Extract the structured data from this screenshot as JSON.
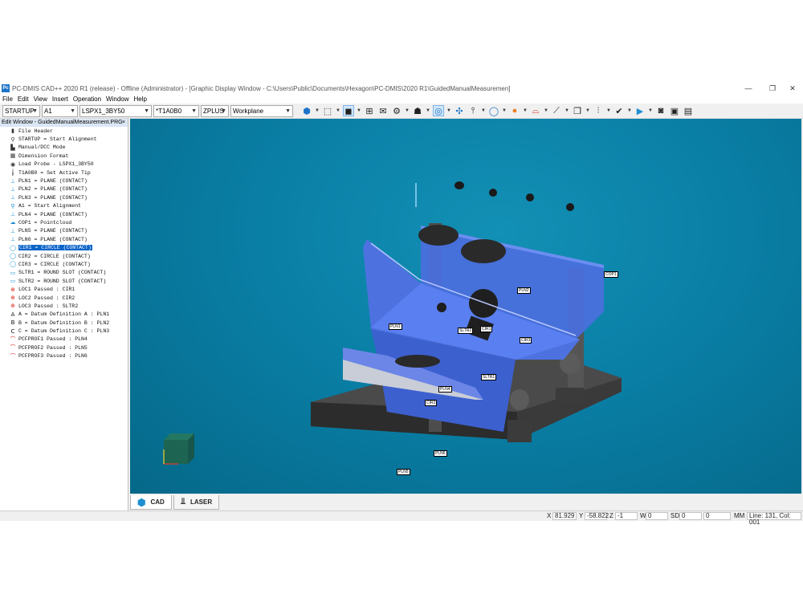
{
  "window": {
    "title": "PC-DMIS CAD++ 2020 R1 (release) - Offline (Administrator) - [Graphic Display Window - C:\\Users\\Public\\Documents\\Hexagon\\PC-DMIS\\2020 R1\\GuidedManualMeasuremen]",
    "logo": "Pc",
    "minimize": "—",
    "maximize": "❐",
    "close": "✕"
  },
  "menu": [
    "File",
    "Edit",
    "View",
    "Insert",
    "Operation",
    "Window",
    "Help"
  ],
  "toolbar": {
    "alignment": "STARTUP",
    "alignment_item": "A1",
    "probe": "LSPX1_3BY50",
    "tip": "*T1A0B0",
    "view": "ZPLUS",
    "workplane": "Workplane"
  },
  "edit_window": {
    "title": "Edit Window - GuidedManualMeasurement.PRG",
    "close": "×",
    "commands": [
      {
        "icon": "file-icon",
        "glyph": "▮",
        "color": "#333333",
        "text": "File Header"
      },
      {
        "icon": "alignment-icon",
        "glyph": "⚲",
        "color": "#333333",
        "text": "STARTUP = Start Alignment"
      },
      {
        "icon": "mode-icon",
        "glyph": "▙",
        "color": "#333333",
        "text": "Manual/DCC Mode"
      },
      {
        "icon": "format-icon",
        "glyph": "▦",
        "color": "#333333",
        "text": "Dimension Format"
      },
      {
        "icon": "probe-icon",
        "glyph": "◉",
        "color": "#333333",
        "text": "Load Probe - LSPX1_3BY50"
      },
      {
        "icon": "tip-icon",
        "glyph": "╽",
        "color": "#333333",
        "text": "T1A0B0 = Set Active Tip"
      },
      {
        "icon": "plane-icon",
        "glyph": "⊥",
        "color": "#1e8fd0",
        "text": "PLN1 = PLANE (CONTACT)"
      },
      {
        "icon": "plane-icon",
        "glyph": "⊥",
        "color": "#1e8fd0",
        "text": "PLN2 = PLANE (CONTACT)"
      },
      {
        "icon": "plane-icon",
        "glyph": "⊥",
        "color": "#1e8fd0",
        "text": "PLN3 = PLANE (CONTACT)"
      },
      {
        "icon": "alignment-icon",
        "glyph": "⚲",
        "color": "#1e8fd0",
        "text": "A1 = Start Alignment"
      },
      {
        "icon": "plane-icon",
        "glyph": "⊥",
        "color": "#1e8fd0",
        "text": "PLN4 = PLANE (CONTACT)"
      },
      {
        "icon": "pointcloud-icon",
        "glyph": "☁",
        "color": "#1e8fd0",
        "text": "COP1 = Pointcloud"
      },
      {
        "icon": "plane-icon",
        "glyph": "⊥",
        "color": "#1e8fd0",
        "text": "PLN5 = PLANE (CONTACT)"
      },
      {
        "icon": "plane-icon",
        "glyph": "⊥",
        "color": "#1e8fd0",
        "text": "PLN6 = PLANE (CONTACT)"
      },
      {
        "icon": "circle-icon",
        "glyph": "◯",
        "color": "#1e8fd0",
        "text": "CIR1 = CIRCLE (CONTACT)",
        "selected": true
      },
      {
        "icon": "circle-icon",
        "glyph": "◯",
        "color": "#1e8fd0",
        "text": "CIR2 = CIRCLE (CONTACT)"
      },
      {
        "icon": "circle-icon",
        "glyph": "◯",
        "color": "#1e8fd0",
        "text": "CIR3 = CIRCLE (CONTACT)"
      },
      {
        "icon": "slot-icon",
        "glyph": "▭",
        "color": "#1e8fd0",
        "text": "SLTR1 = ROUND SLOT (CONTACT)"
      },
      {
        "icon": "slot-icon",
        "glyph": "▭",
        "color": "#1e8fd0",
        "text": "SLTR2 = ROUND SLOT (CONTACT)"
      },
      {
        "icon": "location-icon",
        "glyph": "⊕",
        "color": "#d9281c",
        "text": "LOC1 Passed : CIR1"
      },
      {
        "icon": "location-icon",
        "glyph": "⊕",
        "color": "#d9281c",
        "text": "LOC2 Passed : CIR2"
      },
      {
        "icon": "location-icon",
        "glyph": "⊕",
        "color": "#d9281c",
        "text": "LOC3 Passed : SLTR2"
      },
      {
        "icon": "datum-icon",
        "glyph": "A",
        "color": "#111111",
        "text": "A = Datum Definition A : PLN1"
      },
      {
        "icon": "datum-icon",
        "glyph": "B",
        "color": "#111111",
        "text": "B = Datum Definition B : PLN2"
      },
      {
        "icon": "datum-icon",
        "glyph": "C",
        "color": "#111111",
        "text": "C = Datum Definition C : PLN3"
      },
      {
        "icon": "profile-icon",
        "glyph": "⌒",
        "color": "#d9281c",
        "text": "PCFPROF1 Passed : PLN4"
      },
      {
        "icon": "profile-icon",
        "glyph": "⌒",
        "color": "#d9281c",
        "text": "PCFPROF2 Passed : PLN5"
      },
      {
        "icon": "profile-icon",
        "glyph": "⌒",
        "color": "#d9281c",
        "text": "PCFPROF3 Passed : PLN6"
      }
    ]
  },
  "graphics": {
    "labels": [
      "COP1",
      "PLN2",
      "PLN1",
      "SLTR2",
      "CIR1",
      "CIR3",
      "SLTR1",
      "PLN4",
      "CIR2",
      "PLN6",
      "PLN5"
    ]
  },
  "tabs": [
    {
      "label": "CAD",
      "active": true
    },
    {
      "label": "LASER",
      "active": false
    }
  ],
  "status": {
    "x_label": "X",
    "x_value": "81.929",
    "y_label": "Y",
    "y_value": "-58.822",
    "z_label": "Z",
    "z_value": "-1",
    "w_label": "W",
    "w_value": "0",
    "sd_label": "SD",
    "sd_value": "0",
    "extra_value": "0",
    "units": "MM",
    "cursor": "Line: 131, Col: 001"
  }
}
